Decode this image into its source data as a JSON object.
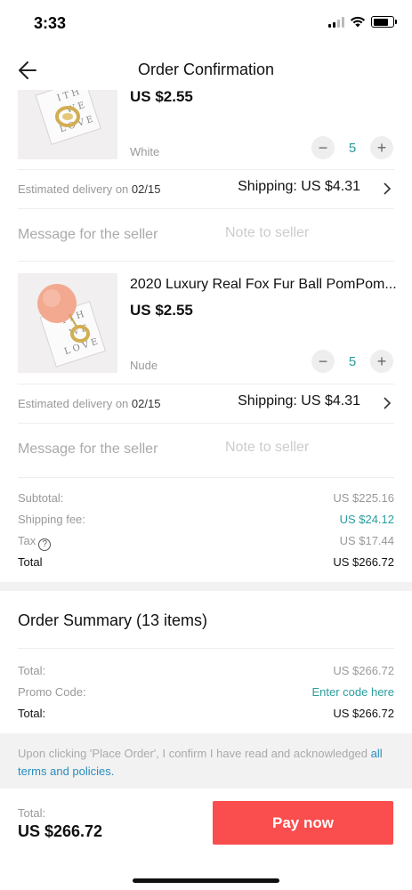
{
  "status_bar": {
    "time": "3:33"
  },
  "nav": {
    "title": "Order Confirmation",
    "back_icon": "arrow-left-icon"
  },
  "items": [
    {
      "title": "",
      "price": "US $2.55",
      "variant": "White",
      "quantity": "5",
      "delivery_prefix": "Estimated delivery on ",
      "delivery_date": "02/15",
      "shipping": "Shipping: US $4.31",
      "message_label": "Message for the seller",
      "message_placeholder": "Note to seller"
    },
    {
      "title": "2020 Luxury Real Fox Fur Ball PomPom...",
      "price": "US $2.55",
      "variant": "Nude",
      "quantity": "5",
      "delivery_prefix": "Estimated delivery on ",
      "delivery_date": "02/15",
      "shipping": "Shipping: US $4.31",
      "message_label": "Message for the seller",
      "message_placeholder": "Note to seller"
    }
  ],
  "subtotals": {
    "subtotal_label": "Subtotal:",
    "subtotal_value": "US $225.16",
    "shipping_label": "Shipping fee:",
    "shipping_value": "US $24.12",
    "tax_label": "Tax",
    "tax_value": "US $17.44",
    "total_label": "Total",
    "total_value": "US $266.72"
  },
  "order_summary": {
    "title": "Order Summary (13 items)",
    "total_label": "Total:",
    "total_value": "US $266.72",
    "promo_label": "Promo Code:",
    "promo_action": "Enter code here",
    "grand_total_label": "Total:",
    "grand_total_value": "US $266.72"
  },
  "terms": {
    "text": "Upon clicking 'Place Order', I confirm I have read and acknowledged ",
    "link": "all terms and policies."
  },
  "footer": {
    "total_label": "Total:",
    "total_value": "US $266.72",
    "pay_button": "Pay now"
  },
  "colors": {
    "accent_teal": "#2a9d9d",
    "pay_red": "#fa4d4d",
    "link_blue": "#2a8dbd"
  }
}
